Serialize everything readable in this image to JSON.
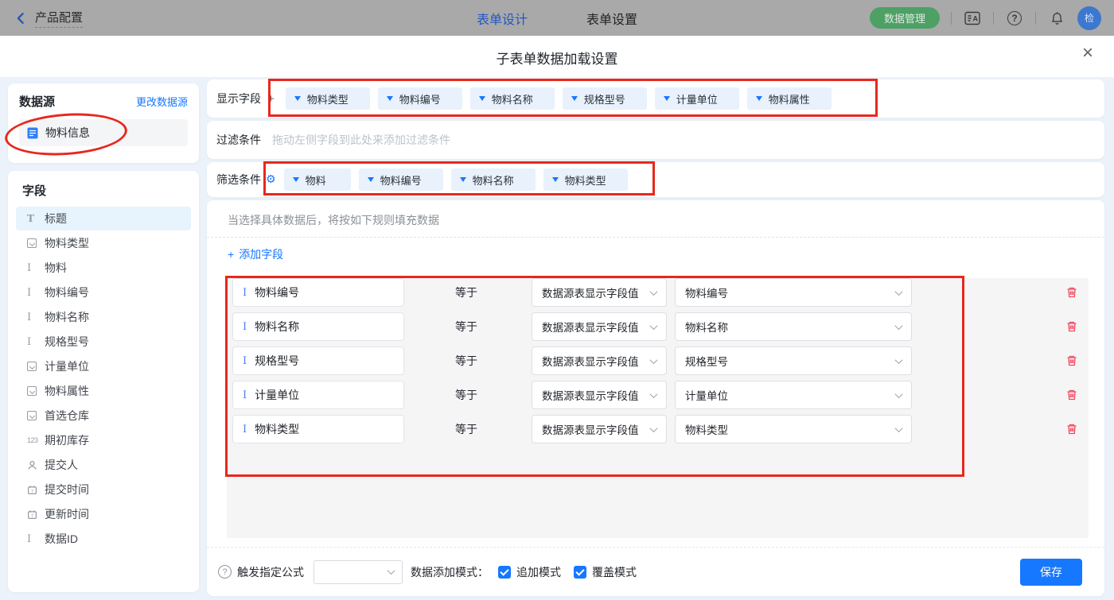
{
  "topbar": {
    "back_label": "产品配置",
    "tab_design": "表单设计",
    "tab_settings": "表单设置",
    "data_manage_label": "数据管理",
    "avatar_label": "检",
    "icons": [
      "back-icon",
      "translate-icon",
      "help-icon",
      "bell-icon"
    ]
  },
  "modal": {
    "title": "子表单数据加载设置",
    "close_glyph": "×"
  },
  "sidebar": {
    "datasource_title": "数据源",
    "change_datasource_label": "更改数据源",
    "datasource_item": "物料信息",
    "fields_title": "字段",
    "fields": [
      {
        "label": "标题",
        "icon": "title-field-icon",
        "highlighted": true
      },
      {
        "label": "物料类型",
        "icon": "select-field-icon"
      },
      {
        "label": "物料",
        "icon": "text-field-icon"
      },
      {
        "label": "物料编号",
        "icon": "text-field-icon"
      },
      {
        "label": "物料名称",
        "icon": "text-field-icon"
      },
      {
        "label": "规格型号",
        "icon": "text-field-icon"
      },
      {
        "label": "计量单位",
        "icon": "select-field-icon"
      },
      {
        "label": "物料属性",
        "icon": "select-field-icon"
      },
      {
        "label": "首选仓库",
        "icon": "select-field-icon"
      },
      {
        "label": "期初库存",
        "icon": "number-field-icon"
      },
      {
        "label": "提交人",
        "icon": "person-field-icon"
      },
      {
        "label": "提交时间",
        "icon": "date-field-icon"
      },
      {
        "label": "更新时间",
        "icon": "date-field-icon"
      },
      {
        "label": "数据ID",
        "icon": "text-field-icon"
      }
    ]
  },
  "main": {
    "display_fields": {
      "label": "显示字段",
      "add_glyph": "+",
      "tags": [
        "物料类型",
        "物料编号",
        "物料名称",
        "规格型号",
        "计量单位",
        "物料属性"
      ]
    },
    "filter_condition": {
      "label": "过滤条件",
      "placeholder": "拖动左侧字段到此处来添加过滤条件"
    },
    "screen_condition": {
      "label": "筛选条件",
      "tags": [
        "物料",
        "物料编号",
        "物料名称",
        "物料类型"
      ]
    },
    "fill_rules": {
      "hint": "当选择具体数据后，将按如下规则填充数据",
      "add_glyph": "+",
      "add_field_label": "添加字段",
      "equals_label": "等于",
      "rows": [
        {
          "field": "物料编号",
          "source": "数据源表显示字段值",
          "target": "物料编号"
        },
        {
          "field": "物料名称",
          "source": "数据源表显示字段值",
          "target": "物料名称"
        },
        {
          "field": "规格型号",
          "source": "数据源表显示字段值",
          "target": "规格型号"
        },
        {
          "field": "计量单位",
          "source": "数据源表显示字段值",
          "target": "计量单位"
        },
        {
          "field": "物料类型",
          "source": "数据源表显示字段值",
          "target": "物料类型"
        }
      ]
    },
    "footer": {
      "formula_label": "触发指定公式",
      "mode_label": "数据添加模式：",
      "append_mode": "追加模式",
      "overwrite_mode": "覆盖模式",
      "save_label": "保存"
    }
  },
  "colors": {
    "accent": "#1677ff",
    "tag_bg": "#e8f1fc",
    "annotation_red": "#e8271d",
    "danger_trash": "#f2495c",
    "green_button": "#4da165",
    "modal_body_bg": "#ecf2fa"
  }
}
